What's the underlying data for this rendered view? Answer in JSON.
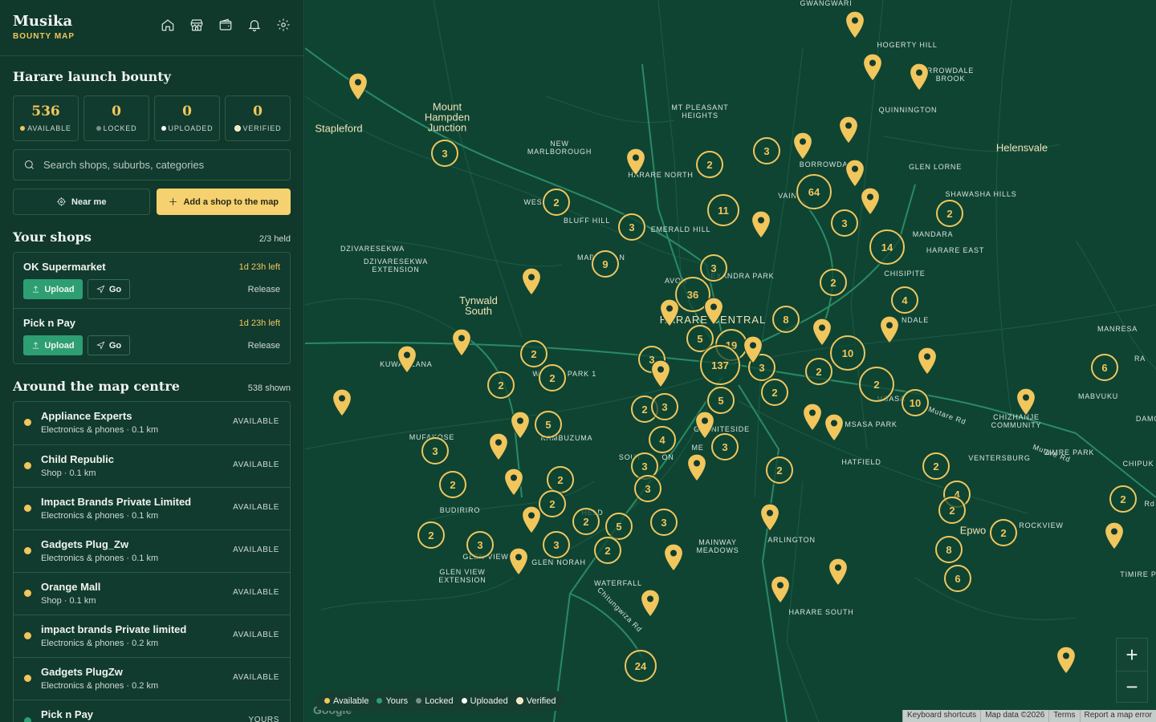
{
  "app": {
    "name": "Musika",
    "subtitle": "BOUNTY MAP"
  },
  "nav": [
    "home-icon",
    "store-icon",
    "wallet-icon",
    "bell-icon",
    "gear-icon"
  ],
  "bounty": {
    "title": "Harare launch bounty",
    "stats": [
      {
        "value": "536",
        "label": "AVAILABLE",
        "color": "#f1c65d"
      },
      {
        "value": "0",
        "label": "LOCKED",
        "color": "#7b8f86"
      },
      {
        "value": "0",
        "label": "UPLOADED",
        "color": "#ffffff"
      },
      {
        "value": "0",
        "label": "VERIFIED",
        "color": "#f5e6b0"
      }
    ]
  },
  "search": {
    "placeholder": "Search shops, suburbs, categories"
  },
  "buttons": {
    "near_me": "Near me",
    "add_shop": "Add a shop to the map"
  },
  "your_shops": {
    "title": "Your shops",
    "count": "2/3 held",
    "items": [
      {
        "name": "OK Supermarket",
        "time_left": "1d 23h left",
        "upload": "Upload",
        "go": "Go",
        "release": "Release"
      },
      {
        "name": "Pick n Pay",
        "time_left": "1d 23h left",
        "upload": "Upload",
        "go": "Go",
        "release": "Release"
      }
    ]
  },
  "around": {
    "title": "Around the map centre",
    "count": "538 shown",
    "items": [
      {
        "name": "Appliance Experts",
        "sub": "Electronics & phones · 0.1 km",
        "status": "AVAILABLE",
        "color": "#f1c65d"
      },
      {
        "name": "Child Republic",
        "sub": "Shop · 0.1 km",
        "status": "AVAILABLE",
        "color": "#f1c65d"
      },
      {
        "name": "Impact Brands Private Limited",
        "sub": "Electronics & phones · 0.1 km",
        "status": "AVAILABLE",
        "color": "#f1c65d"
      },
      {
        "name": "Gadgets Plug_Zw",
        "sub": "Electronics & phones · 0.1 km",
        "status": "AVAILABLE",
        "color": "#f1c65d"
      },
      {
        "name": "Orange Mall",
        "sub": "Shop · 0.1 km",
        "status": "AVAILABLE",
        "color": "#f1c65d"
      },
      {
        "name": "impact brands Private limited",
        "sub": "Electronics & phones · 0.2 km",
        "status": "AVAILABLE",
        "color": "#f1c65d"
      },
      {
        "name": "Gadgets PlugZw",
        "sub": "Electronics & phones · 0.2 km",
        "status": "AVAILABLE",
        "color": "#f1c65d"
      },
      {
        "name": "Pick n Pay",
        "sub": "",
        "status": "YOURS",
        "color": "#2d9f73"
      }
    ]
  },
  "map": {
    "labels": [
      {
        "text": "GWANGWARI"
      },
      {
        "text": "HOGERTY HILL"
      },
      {
        "text": "RROWDALE BROOK"
      },
      {
        "text": "QUINNINGTON"
      },
      {
        "text": "Helensvale"
      },
      {
        "text": "GLEN LORNE"
      },
      {
        "text": "SHAWASHA HILLS"
      },
      {
        "text": "MANDARA"
      },
      {
        "text": "HARARE EAST"
      },
      {
        "text": "CHISIPITE"
      },
      {
        "text": "Mount Hampden Junction"
      },
      {
        "text": "Stapleford"
      },
      {
        "text": "MT PLEASANT HEIGHTS"
      },
      {
        "text": "NEW MARLBOROUGH"
      },
      {
        "text": "HARARE NORTH"
      },
      {
        "text": "BORROWDA"
      },
      {
        "text": "WES"
      },
      {
        "text": "BLUFF HILL"
      },
      {
        "text": "EMERALD HILL"
      },
      {
        "text": "VAIN"
      },
      {
        "text": "DZIVARESEKWA"
      },
      {
        "text": "DZIVARESEKWA EXTENSION"
      },
      {
        "text": "MAB"
      },
      {
        "text": "N"
      },
      {
        "text": "EXANDRA PARK"
      },
      {
        "text": "AVON"
      },
      {
        "text": "Tynwald South"
      },
      {
        "text": "HARARE CENTRAL"
      },
      {
        "text": "KUWA"
      },
      {
        "text": "ZANA"
      },
      {
        "text": "W"
      },
      {
        "text": "PARK 1"
      },
      {
        "text": "NDALE"
      },
      {
        "text": "MANRESA"
      },
      {
        "text": "MUFAKOSE"
      },
      {
        "text": "KAMBUZUMA"
      },
      {
        "text": "GRANITESIDE"
      },
      {
        "text": "MSASA PARK"
      },
      {
        "text": "MSASA"
      },
      {
        "text": "MABVUKU"
      },
      {
        "text": "CHIZHANJE COMMUNITY"
      },
      {
        "text": "DAMO"
      },
      {
        "text": "ZIMRE PARK"
      },
      {
        "text": "CHIPUK"
      },
      {
        "text": "Mutare Rd"
      },
      {
        "text": "Mutare Rd"
      },
      {
        "text": "HATFIELD"
      },
      {
        "text": "SOUT"
      },
      {
        "text": "ON"
      },
      {
        "text": "ME"
      },
      {
        "text": "BUDIRIRO"
      },
      {
        "text": "HELD"
      },
      {
        "text": "VENTERSBURG"
      },
      {
        "text": "ROCKVIEW"
      },
      {
        "text": "Epwo"
      },
      {
        "text": "TIMIRE P"
      },
      {
        "text": "GLEN VIEW"
      },
      {
        "text": "GLEN VIEW EXTENSION"
      },
      {
        "text": "GLEN NORAH"
      },
      {
        "text": "MAINWAY MEADOWS"
      },
      {
        "text": "ARLINGTON"
      },
      {
        "text": "WATERFALL"
      },
      {
        "text": "HARARE SOUTH"
      },
      {
        "text": "Chitungwiza Rd"
      },
      {
        "text": "RA"
      },
      {
        "text": "Rd"
      }
    ],
    "clusters": [
      "3",
      "2",
      "3",
      "2",
      "3",
      "64",
      "2",
      "11",
      "3",
      "9",
      "3",
      "14",
      "2",
      "36",
      "4",
      "8",
      "2",
      "10",
      "5",
      "19",
      "137",
      "3",
      "2",
      "3",
      "6",
      "2",
      "2",
      "2",
      "2",
      "3",
      "5",
      "2",
      "10",
      "5",
      "3",
      "2",
      "3",
      "2",
      "4",
      "3",
      "3",
      "2",
      "2",
      "2",
      "5",
      "2",
      "3",
      "2",
      "4",
      "2",
      "3",
      "2",
      "3",
      "2",
      "2",
      "8",
      "6",
      "24"
    ],
    "pin_count": 38
  },
  "legend": [
    {
      "label": "Available",
      "color": "#f1c65d"
    },
    {
      "label": "Yours",
      "color": "#2d9f73"
    },
    {
      "label": "Locked",
      "color": "#7b8f86"
    },
    {
      "label": "Uploaded",
      "color": "#ffffff"
    },
    {
      "label": "Verified",
      "color": "#f5e6b0"
    }
  ],
  "attribution": [
    "Keyboard shortcuts",
    "Map data ©2026",
    "Terms",
    "Report a map error"
  ],
  "google": "Google"
}
